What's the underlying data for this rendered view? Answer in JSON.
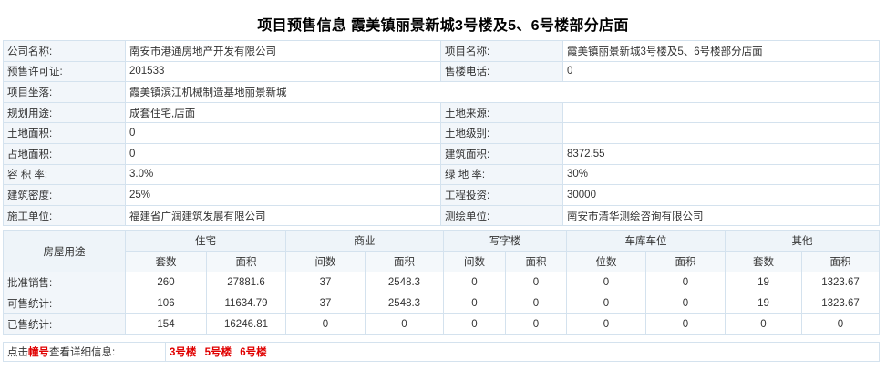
{
  "title": "项目预售信息  霞美镇丽景新城3号楼及5、6号楼部分店面",
  "info": {
    "company_label": "公司名称:",
    "company": "南安市港通房地产开发有限公司",
    "project_label": "项目名称:",
    "project": "霞美镇丽景新城3号楼及5、6号楼部分店面",
    "permit_label": "预售许可证:",
    "permit": "201533",
    "phone_label": "售楼电话:",
    "phone": "0",
    "location_label": "项目坐落:",
    "location": "霞美镇滨江机械制造基地丽景新城",
    "usage_label": "规划用途:",
    "usage": "成套住宅,店面",
    "land_source_label": "土地来源:",
    "land_source": "",
    "land_area_label": "土地面积:",
    "land_area": "0",
    "land_grade_label": "土地级别:",
    "land_grade": "",
    "occupied_label": "占地面积:",
    "occupied": "0",
    "building_area_label": "建筑面积:",
    "building_area": "8372.55",
    "plot_ratio_label": "容 积 率:",
    "plot_ratio": "3.0%",
    "green_label": "绿 地 率:",
    "green": "30%",
    "density_label": "建筑密度:",
    "density": "25%",
    "investment_label": "工程投资:",
    "investment": "30000",
    "builder_label": "施工单位:",
    "builder": "福建省广润建筑发展有限公司",
    "surveyor_label": "测绘单位:",
    "surveyor": "南安市清华测绘咨询有限公司"
  },
  "stats": {
    "house_use": "房屋用途",
    "groups": [
      "住宅",
      "商业",
      "写字楼",
      "车库车位",
      "其他"
    ],
    "sub": [
      "套数",
      "面积",
      "间数",
      "面积",
      "间数",
      "面积",
      "位数",
      "面积",
      "套数",
      "面积"
    ],
    "rows": [
      {
        "label": "批准销售:",
        "cells": [
          "260",
          "27881.6",
          "37",
          "2548.3",
          "0",
          "0",
          "0",
          "0",
          "19",
          "1323.67"
        ]
      },
      {
        "label": "可售统计:",
        "cells": [
          "106",
          "11634.79",
          "37",
          "2548.3",
          "0",
          "0",
          "0",
          "0",
          "19",
          "1323.67"
        ]
      },
      {
        "label": "已售统计:",
        "cells": [
          "154",
          "16246.81",
          "0",
          "0",
          "0",
          "0",
          "0",
          "0",
          "0",
          "0"
        ]
      }
    ]
  },
  "bottom": {
    "prefix": "点击",
    "highlight": "幢号",
    "suffix": "查看详细信息:",
    "buildings": [
      "3号楼",
      "5号楼",
      "6号楼"
    ]
  }
}
